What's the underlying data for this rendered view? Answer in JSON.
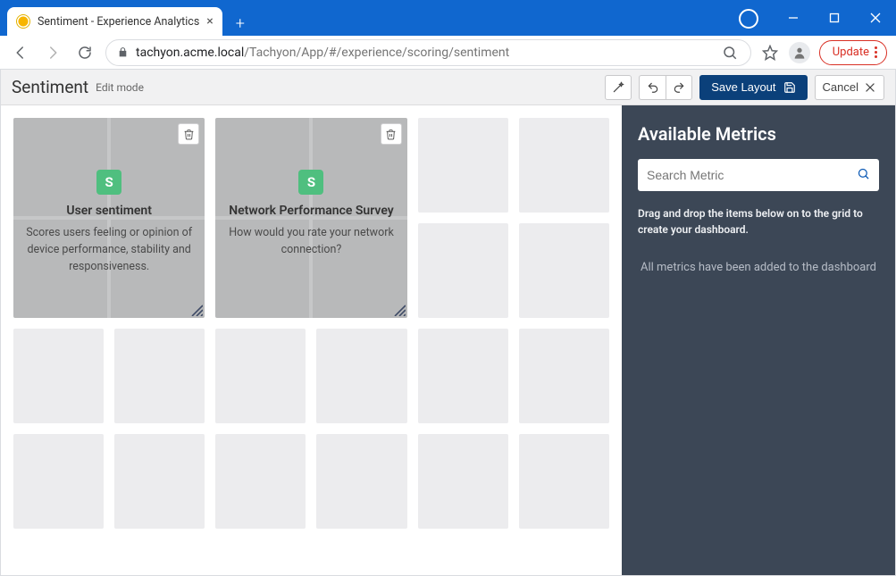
{
  "browser": {
    "tab_title": "Sentiment - Experience Analytics",
    "url_host": "tachyon.acme.local",
    "url_path": "/Tachyon/App/#/experience/scoring/sentiment",
    "update_label": "Update"
  },
  "header": {
    "title": "Sentiment",
    "mode": "Edit mode",
    "save_label": "Save Layout",
    "cancel_label": "Cancel"
  },
  "tiles": [
    {
      "icon_letter": "S",
      "title": "User sentiment",
      "description": "Scores users feeling or opinion of device performance, stability and responsiveness."
    },
    {
      "icon_letter": "S",
      "title": "Network Performance Survey",
      "description": "How would you rate your network connection?"
    }
  ],
  "sidebar": {
    "title": "Available Metrics",
    "search_placeholder": "Search Metric",
    "hint": "Drag and drop the items below on to the grid to create your dashboard.",
    "empty_message": "All metrics have been added to the dashboard"
  }
}
